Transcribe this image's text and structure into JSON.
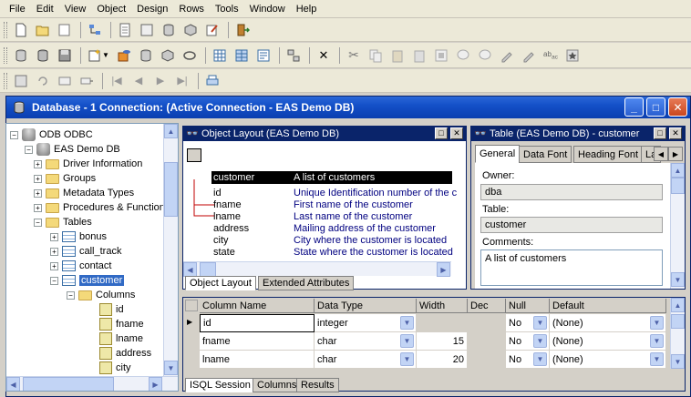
{
  "menu": [
    "File",
    "Edit",
    "View",
    "Object",
    "Design",
    "Rows",
    "Tools",
    "Window",
    "Help"
  ],
  "mdi": {
    "title": "Database - 1 Connection: (Active Connection - EAS Demo DB)"
  },
  "tree": {
    "root": "ODB ODBC",
    "db": "EAS Demo DB",
    "items": [
      "Driver Information",
      "Groups",
      "Metadata Types",
      "Procedures & Functions",
      "Tables"
    ],
    "tables": [
      "bonus",
      "call_track",
      "contact",
      "customer"
    ],
    "columns_folder": "Columns",
    "columns": [
      "id",
      "fname",
      "lname",
      "address",
      "city"
    ]
  },
  "object_layout": {
    "title": "Object Layout (EAS Demo DB)",
    "header": {
      "name": "customer",
      "desc": "A list of customers"
    },
    "rows": [
      {
        "name": "id",
        "desc": "Unique Identification number of the c"
      },
      {
        "name": "fname",
        "desc": "First name of the customer"
      },
      {
        "name": "lname",
        "desc": "Last name of the customer"
      },
      {
        "name": "address",
        "desc": "Mailing address of the customer"
      },
      {
        "name": "city",
        "desc": "City where the customer is located"
      },
      {
        "name": "state",
        "desc": "State where the customer is located"
      }
    ],
    "tabs": [
      "Object Layout",
      "Extended Attributes"
    ]
  },
  "table_panel": {
    "title": "Table (EAS Demo DB) - customer",
    "tabs": [
      "General",
      "Data Font",
      "Heading Font",
      "La"
    ],
    "owner_label": "Owner:",
    "owner": "dba",
    "table_label": "Table:",
    "table": "customer",
    "comments_label": "Comments:",
    "comments": "A list of customers"
  },
  "columns_grid": {
    "headers": [
      "Column Name",
      "Data Type",
      "Width",
      "Dec",
      "Null",
      "Default"
    ],
    "rows": [
      {
        "name": "id",
        "type": "integer",
        "width": "",
        "dec": "",
        "null": "No",
        "default": "(None)"
      },
      {
        "name": "fname",
        "type": "char",
        "width": "15",
        "dec": "",
        "null": "No",
        "default": "(None)"
      },
      {
        "name": "lname",
        "type": "char",
        "width": "20",
        "dec": "",
        "null": "No",
        "default": "(None)"
      }
    ]
  },
  "bottom_tabs": [
    "ISQL Session",
    "Columns",
    "Results"
  ]
}
